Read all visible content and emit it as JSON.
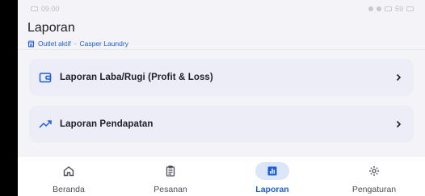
{
  "status_bar": {
    "time": "09.00",
    "battery": "59"
  },
  "header": {
    "title": "Laporan",
    "outlet_label": "Outlet aktif",
    "separator": "·",
    "outlet_name": "Casper Laundry"
  },
  "menu": [
    {
      "label": "Laporan Laba/Rugi (Profit & Loss)",
      "icon": "wallet-icon"
    },
    {
      "label": "Laporan Pendapatan",
      "icon": "trending-up-icon"
    }
  ],
  "nav": [
    {
      "label": "Beranda",
      "icon": "home-icon",
      "active": false
    },
    {
      "label": "Pesanan",
      "icon": "clipboard-icon",
      "active": false
    },
    {
      "label": "Laporan",
      "icon": "bar-chart-icon",
      "active": true
    },
    {
      "label": "Pengaturan",
      "icon": "gear-icon",
      "active": false
    }
  ],
  "colors": {
    "accent": "#1e5fd6",
    "active_pill": "#dbe6fb",
    "card": "#ecedf6",
    "background": "#f3f3f8"
  }
}
